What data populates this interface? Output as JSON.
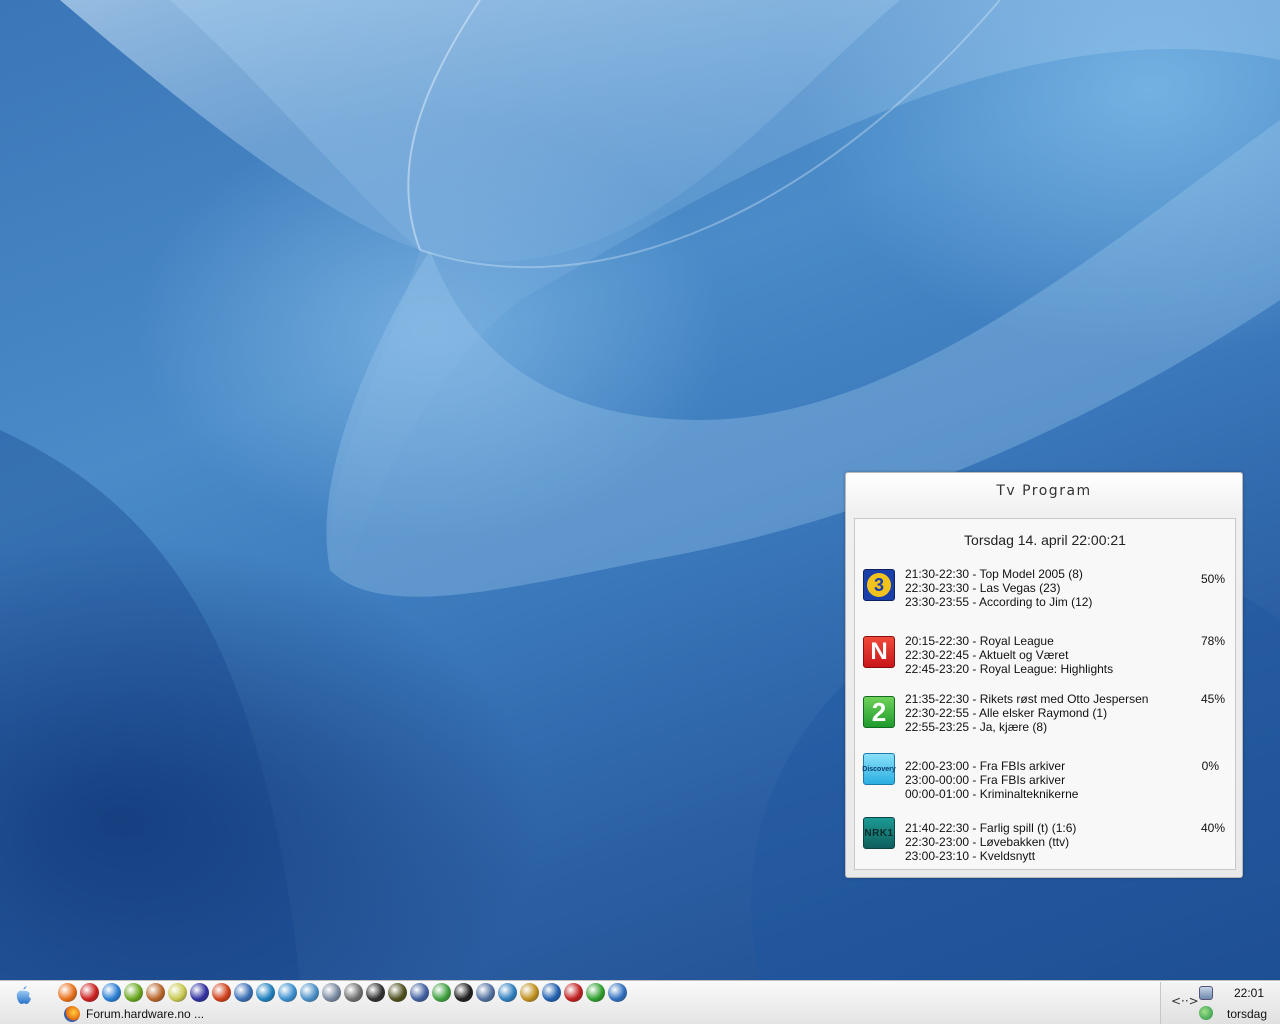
{
  "widget": {
    "title": "Tv Program",
    "date": "Torsdag 14. april 22:00:21",
    "channels": [
      {
        "icon": "tv3-icon",
        "logo_text": "3",
        "color": "#1a3fa8",
        "lines": [
          "21:30-22:30 - Top Model 2005 (8)",
          "22:30-23:30 - Las Vegas (23)",
          "23:30-23:55 - According to Jim (12)"
        ],
        "progress": "50%"
      },
      {
        "icon": "tvnorge-icon",
        "logo_text": "N",
        "color": "#d8261f",
        "lines": [
          "20:15-22:30 - Royal League",
          "22:30-22:45 - Aktuelt og Været",
          "22:45-23:20 - Royal League: Highlights"
        ],
        "progress": "78%"
      },
      {
        "icon": "tv2-icon",
        "logo_text": "2",
        "color": "#2eae3a",
        "lines": [
          "21:35-22:30 - Rikets røst med Otto Jespersen",
          "22:30-22:55 - Alle elsker Raymond (1)",
          "22:55-23:25 - Ja, kjære (8)"
        ],
        "progress": "45%"
      },
      {
        "icon": "discovery-icon",
        "logo_text": "Discovery",
        "color": "#3cb7e6",
        "lines": [
          "22:00-23:00 - Fra FBIs arkiver",
          "23:00-00:00 - Fra FBIs arkiver",
          "00:00-01:00 - Kriminalteknikerne"
        ],
        "progress": "0%"
      },
      {
        "icon": "nrk1-icon",
        "logo_text": "NRK1",
        "color": "#137a76",
        "lines": [
          "21:40-22:30 - Farlig spill (t) (1:6)",
          "22:30-23:00 - Løvebakken (ttv)",
          "23:00-23:10 - Kveldsnytt"
        ],
        "progress": "40%"
      }
    ]
  },
  "taskbar": {
    "task_label": "Forum.hardware.no ...",
    "clock_time": "22:01",
    "clock_day": "torsdag",
    "tray_arrow": "<··>"
  },
  "quicklaunch": [
    {
      "icon": "firefox-icon",
      "color": "#e8701a"
    },
    {
      "icon": "opera-icon",
      "color": "#cc1f1f"
    },
    {
      "icon": "ie-icon",
      "color": "#2a7fd4"
    },
    {
      "icon": "winamp-icon",
      "color": "#6aa81f"
    },
    {
      "icon": "app-icon",
      "color": "#b8652a"
    },
    {
      "icon": "eye-icon",
      "color": "#c8c850"
    },
    {
      "icon": "game-icon",
      "color": "#3030a0"
    },
    {
      "icon": "record-icon",
      "color": "#d0401a"
    },
    {
      "icon": "folder-icon",
      "color": "#3b6fb6"
    },
    {
      "icon": "pen-icon",
      "color": "#2080c0"
    },
    {
      "icon": "magnifier-icon",
      "color": "#3a8fd0"
    },
    {
      "icon": "chat-icon",
      "color": "#4a90c8"
    },
    {
      "icon": "disk-icon",
      "color": "#7888a0"
    },
    {
      "icon": "printer-icon",
      "color": "#707070"
    },
    {
      "icon": "cs-icon",
      "color": "#303030"
    },
    {
      "icon": "film-icon",
      "color": "#505020"
    },
    {
      "icon": "audio-icon",
      "color": "#4060a0"
    },
    {
      "icon": "recycle-icon",
      "color": "#40a040"
    },
    {
      "icon": "steam-icon",
      "color": "#202020"
    },
    {
      "icon": "tools-icon",
      "color": "#5070a0"
    },
    {
      "icon": "refresh-icon",
      "color": "#2f80c0"
    },
    {
      "icon": "wrench-icon",
      "color": "#c09020"
    },
    {
      "icon": "media-icon",
      "color": "#2060b0"
    },
    {
      "icon": "flash-icon",
      "color": "#c02020"
    },
    {
      "icon": "ball-icon",
      "color": "#30a030"
    },
    {
      "icon": "globe-icon",
      "color": "#3070c0"
    }
  ]
}
